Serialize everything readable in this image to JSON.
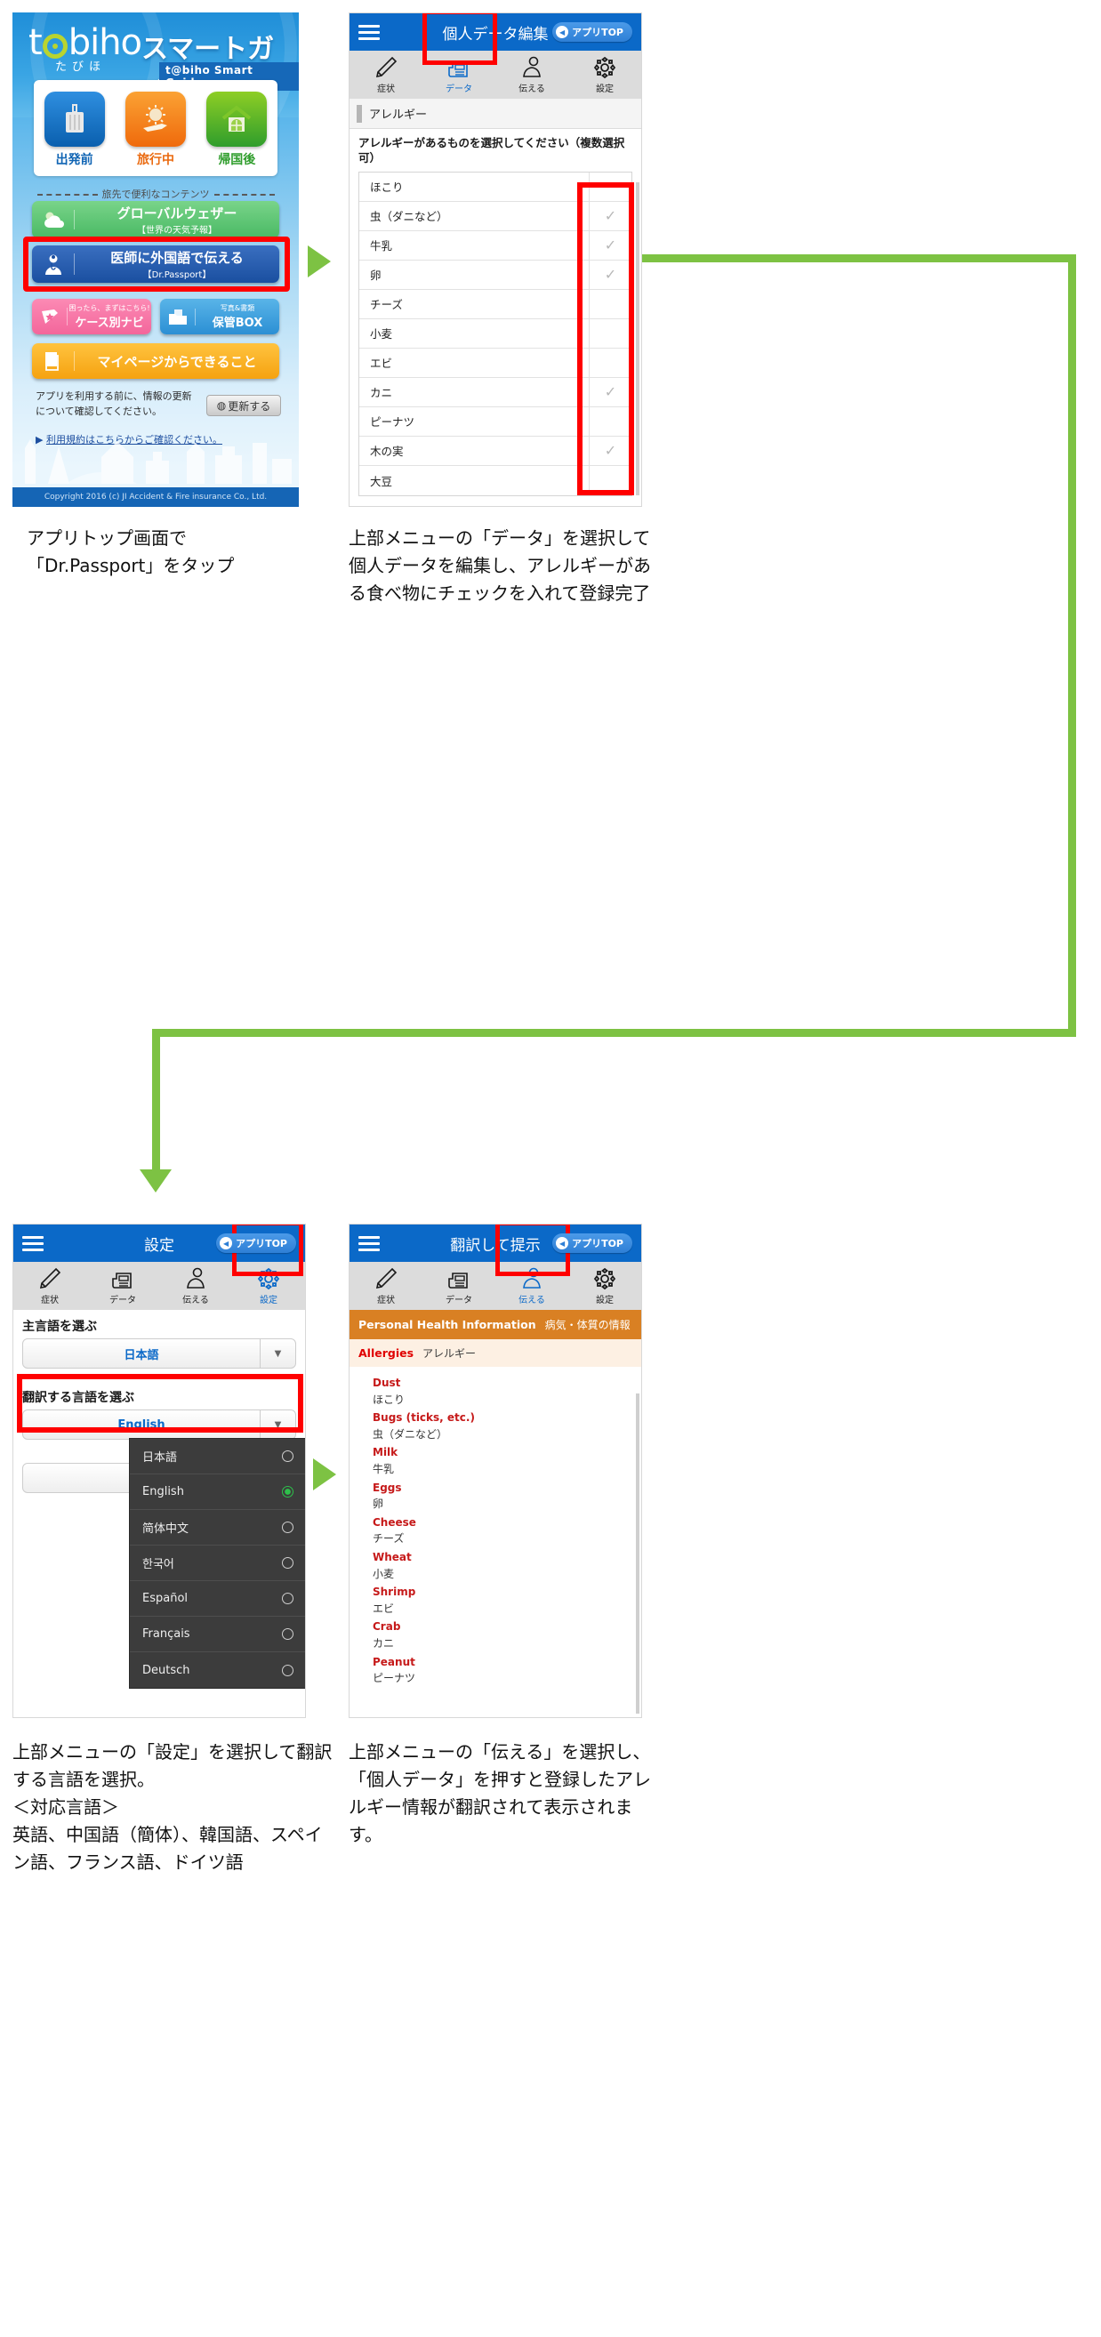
{
  "screen1": {
    "logo": {
      "word_pre": "t",
      "word_post": "biho",
      "reg": "®",
      "kana": "たびほ",
      "smart": "スマートガイド",
      "english": "t@biho Smart Guide"
    },
    "tiles": [
      {
        "label": "出発前",
        "icon": "suitcase-icon"
      },
      {
        "label": "旅行中",
        "icon": "sun-plane-icon"
      },
      {
        "label": "帰国後",
        "icon": "house-icon"
      }
    ],
    "divider_text": "旅先で便利なコンテンツ",
    "buttons": [
      {
        "title": "グローバルウェザー",
        "sub": "【世界の天気予報】",
        "icon": "weather-icon"
      },
      {
        "title": "医師に外国語で伝える",
        "sub": "【Dr.Passport】",
        "icon": "doctor-icon"
      },
      {
        "title": "ケース別ナビ",
        "sub": "困ったら、まずはこちら!",
        "icon": "star-card-icon"
      },
      {
        "title": "保管BOX",
        "sub": "写真&書類",
        "icon": "folder-icon"
      },
      {
        "title": "マイページからできること",
        "sub": "",
        "icon": "page-arrow-icon"
      }
    ],
    "note": "アプリを利用する前に、情報の更新について確認してください。",
    "update_button": "更新する",
    "terms_link": "利用規約はこちらからご確認ください。",
    "arrow_marker": "▶",
    "footer": "Copyright 2016 (c) JI Accident & Fire insurance Co., Ltd."
  },
  "screen2": {
    "title": "個人データ編集",
    "app_top_label": "アプリTOP",
    "tabs": [
      {
        "label": "症状",
        "icon": "pencil-icon",
        "active": false
      },
      {
        "label": "データ",
        "icon": "document-icon",
        "active": true
      },
      {
        "label": "伝える",
        "icon": "person-icon",
        "active": false
      },
      {
        "label": "設定",
        "icon": "gear-icon",
        "active": false
      }
    ],
    "section_header": "アレルギー",
    "question": "アレルギーがあるものを選択してください（複数選択可）",
    "allergy_rows": [
      {
        "label": "ほこり",
        "checked": false
      },
      {
        "label": "虫（ダニなど）",
        "checked": true
      },
      {
        "label": "牛乳",
        "checked": true
      },
      {
        "label": "卵",
        "checked": true
      },
      {
        "label": "チーズ",
        "checked": false
      },
      {
        "label": "小麦",
        "checked": false
      },
      {
        "label": "エビ",
        "checked": false
      },
      {
        "label": "カニ",
        "checked": true
      },
      {
        "label": "ピーナツ",
        "checked": false
      },
      {
        "label": "木の実",
        "checked": true
      },
      {
        "label": "大豆",
        "checked": false
      }
    ],
    "check_glyph": "✓"
  },
  "screen3": {
    "title": "設定",
    "app_top_label": "アプリTOP",
    "tabs": [
      {
        "label": "症状",
        "icon": "pencil-icon",
        "active": false
      },
      {
        "label": "データ",
        "icon": "document-icon",
        "active": false
      },
      {
        "label": "伝える",
        "icon": "person-icon",
        "active": false
      },
      {
        "label": "設定",
        "icon": "gear-icon",
        "active": true
      }
    ],
    "primary_language_label": "主言語を選ぶ",
    "primary_language_value": "日本語",
    "translate_language_label": "翻訳する言語を選ぶ",
    "translate_language_value": "English",
    "caret_glyph": "▼",
    "language_menu": [
      {
        "label": "日本語",
        "selected": false
      },
      {
        "label": "English",
        "selected": true
      },
      {
        "label": "简体中文",
        "selected": false
      },
      {
        "label": "한국어",
        "selected": false
      },
      {
        "label": "Español",
        "selected": false
      },
      {
        "label": "Français",
        "selected": false
      },
      {
        "label": "Deutsch",
        "selected": false
      }
    ]
  },
  "screen4": {
    "title": "翻訳して提示",
    "app_top_label": "アプリTOP",
    "tabs": [
      {
        "label": "症状",
        "icon": "pencil-icon",
        "active": false
      },
      {
        "label": "データ",
        "icon": "document-icon",
        "active": false
      },
      {
        "label": "伝える",
        "icon": "person-icon",
        "active": true
      },
      {
        "label": "設定",
        "icon": "gear-icon",
        "active": false
      }
    ],
    "section_en": "Personal Health Information",
    "section_jp": "病気・体質の情報",
    "allergies_en": "Allergies",
    "allergies_jp": "アレルギー",
    "items": [
      {
        "en": "Dust",
        "jp": "ほこり"
      },
      {
        "en": "Bugs (ticks, etc.)",
        "jp": "虫（ダニなど）"
      },
      {
        "en": "Milk",
        "jp": "牛乳"
      },
      {
        "en": "Eggs",
        "jp": "卵"
      },
      {
        "en": "Cheese",
        "jp": "チーズ"
      },
      {
        "en": "Wheat",
        "jp": "小麦"
      },
      {
        "en": "Shrimp",
        "jp": "エビ"
      },
      {
        "en": "Crab",
        "jp": "カニ"
      },
      {
        "en": "Peanut",
        "jp": "ピーナツ"
      }
    ]
  },
  "captions": {
    "cap1": "アプリトップ画面で\n「Dr.Passport」をタップ",
    "cap2": "上部メニューの「データ」を選択して個人データを編集し、アレルギーがある食べ物にチェックを入れて登録完了",
    "cap3": "上部メニューの「設定」を選択して翻訳する言語を選択。\n＜対応言語＞\n英語、中国語（簡体）、韓国語、スペイン語、フランス語、ドイツ語",
    "cap4": "上部メニューの「伝える」を選択し、「個人データ」を押すと登録したアレルギー情報が翻訳されて表示されます。"
  },
  "colors": {
    "brand_blue": "#0b69c8",
    "highlight_red": "#ff0000",
    "arrow_green": "#7dc243",
    "orange_header": "#d98023",
    "allergy_red": "#c61a1a"
  }
}
